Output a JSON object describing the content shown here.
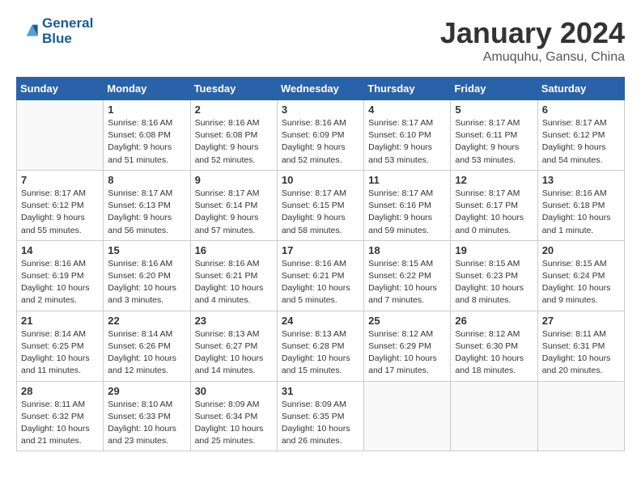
{
  "header": {
    "logo_general": "General",
    "logo_blue": "Blue",
    "title": "January 2024",
    "location": "Amuquhu, Gansu, China"
  },
  "days_of_week": [
    "Sunday",
    "Monday",
    "Tuesday",
    "Wednesday",
    "Thursday",
    "Friday",
    "Saturday"
  ],
  "weeks": [
    [
      {
        "day": "",
        "sunrise": "",
        "sunset": "",
        "daylight": ""
      },
      {
        "day": "1",
        "sunrise": "Sunrise: 8:16 AM",
        "sunset": "Sunset: 6:08 PM",
        "daylight": "Daylight: 9 hours and 51 minutes."
      },
      {
        "day": "2",
        "sunrise": "Sunrise: 8:16 AM",
        "sunset": "Sunset: 6:08 PM",
        "daylight": "Daylight: 9 hours and 52 minutes."
      },
      {
        "day": "3",
        "sunrise": "Sunrise: 8:16 AM",
        "sunset": "Sunset: 6:09 PM",
        "daylight": "Daylight: 9 hours and 52 minutes."
      },
      {
        "day": "4",
        "sunrise": "Sunrise: 8:17 AM",
        "sunset": "Sunset: 6:10 PM",
        "daylight": "Daylight: 9 hours and 53 minutes."
      },
      {
        "day": "5",
        "sunrise": "Sunrise: 8:17 AM",
        "sunset": "Sunset: 6:11 PM",
        "daylight": "Daylight: 9 hours and 53 minutes."
      },
      {
        "day": "6",
        "sunrise": "Sunrise: 8:17 AM",
        "sunset": "Sunset: 6:12 PM",
        "daylight": "Daylight: 9 hours and 54 minutes."
      }
    ],
    [
      {
        "day": "7",
        "sunrise": "Sunrise: 8:17 AM",
        "sunset": "Sunset: 6:12 PM",
        "daylight": "Daylight: 9 hours and 55 minutes."
      },
      {
        "day": "8",
        "sunrise": "Sunrise: 8:17 AM",
        "sunset": "Sunset: 6:13 PM",
        "daylight": "Daylight: 9 hours and 56 minutes."
      },
      {
        "day": "9",
        "sunrise": "Sunrise: 8:17 AM",
        "sunset": "Sunset: 6:14 PM",
        "daylight": "Daylight: 9 hours and 57 minutes."
      },
      {
        "day": "10",
        "sunrise": "Sunrise: 8:17 AM",
        "sunset": "Sunset: 6:15 PM",
        "daylight": "Daylight: 9 hours and 58 minutes."
      },
      {
        "day": "11",
        "sunrise": "Sunrise: 8:17 AM",
        "sunset": "Sunset: 6:16 PM",
        "daylight": "Daylight: 9 hours and 59 minutes."
      },
      {
        "day": "12",
        "sunrise": "Sunrise: 8:17 AM",
        "sunset": "Sunset: 6:17 PM",
        "daylight": "Daylight: 10 hours and 0 minutes."
      },
      {
        "day": "13",
        "sunrise": "Sunrise: 8:16 AM",
        "sunset": "Sunset: 6:18 PM",
        "daylight": "Daylight: 10 hours and 1 minute."
      }
    ],
    [
      {
        "day": "14",
        "sunrise": "Sunrise: 8:16 AM",
        "sunset": "Sunset: 6:19 PM",
        "daylight": "Daylight: 10 hours and 2 minutes."
      },
      {
        "day": "15",
        "sunrise": "Sunrise: 8:16 AM",
        "sunset": "Sunset: 6:20 PM",
        "daylight": "Daylight: 10 hours and 3 minutes."
      },
      {
        "day": "16",
        "sunrise": "Sunrise: 8:16 AM",
        "sunset": "Sunset: 6:21 PM",
        "daylight": "Daylight: 10 hours and 4 minutes."
      },
      {
        "day": "17",
        "sunrise": "Sunrise: 8:16 AM",
        "sunset": "Sunset: 6:21 PM",
        "daylight": "Daylight: 10 hours and 5 minutes."
      },
      {
        "day": "18",
        "sunrise": "Sunrise: 8:15 AM",
        "sunset": "Sunset: 6:22 PM",
        "daylight": "Daylight: 10 hours and 7 minutes."
      },
      {
        "day": "19",
        "sunrise": "Sunrise: 8:15 AM",
        "sunset": "Sunset: 6:23 PM",
        "daylight": "Daylight: 10 hours and 8 minutes."
      },
      {
        "day": "20",
        "sunrise": "Sunrise: 8:15 AM",
        "sunset": "Sunset: 6:24 PM",
        "daylight": "Daylight: 10 hours and 9 minutes."
      }
    ],
    [
      {
        "day": "21",
        "sunrise": "Sunrise: 8:14 AM",
        "sunset": "Sunset: 6:25 PM",
        "daylight": "Daylight: 10 hours and 11 minutes."
      },
      {
        "day": "22",
        "sunrise": "Sunrise: 8:14 AM",
        "sunset": "Sunset: 6:26 PM",
        "daylight": "Daylight: 10 hours and 12 minutes."
      },
      {
        "day": "23",
        "sunrise": "Sunrise: 8:13 AM",
        "sunset": "Sunset: 6:27 PM",
        "daylight": "Daylight: 10 hours and 14 minutes."
      },
      {
        "day": "24",
        "sunrise": "Sunrise: 8:13 AM",
        "sunset": "Sunset: 6:28 PM",
        "daylight": "Daylight: 10 hours and 15 minutes."
      },
      {
        "day": "25",
        "sunrise": "Sunrise: 8:12 AM",
        "sunset": "Sunset: 6:29 PM",
        "daylight": "Daylight: 10 hours and 17 minutes."
      },
      {
        "day": "26",
        "sunrise": "Sunrise: 8:12 AM",
        "sunset": "Sunset: 6:30 PM",
        "daylight": "Daylight: 10 hours and 18 minutes."
      },
      {
        "day": "27",
        "sunrise": "Sunrise: 8:11 AM",
        "sunset": "Sunset: 6:31 PM",
        "daylight": "Daylight: 10 hours and 20 minutes."
      }
    ],
    [
      {
        "day": "28",
        "sunrise": "Sunrise: 8:11 AM",
        "sunset": "Sunset: 6:32 PM",
        "daylight": "Daylight: 10 hours and 21 minutes."
      },
      {
        "day": "29",
        "sunrise": "Sunrise: 8:10 AM",
        "sunset": "Sunset: 6:33 PM",
        "daylight": "Daylight: 10 hours and 23 minutes."
      },
      {
        "day": "30",
        "sunrise": "Sunrise: 8:09 AM",
        "sunset": "Sunset: 6:34 PM",
        "daylight": "Daylight: 10 hours and 25 minutes."
      },
      {
        "day": "31",
        "sunrise": "Sunrise: 8:09 AM",
        "sunset": "Sunset: 6:35 PM",
        "daylight": "Daylight: 10 hours and 26 minutes."
      },
      {
        "day": "",
        "sunrise": "",
        "sunset": "",
        "daylight": ""
      },
      {
        "day": "",
        "sunrise": "",
        "sunset": "",
        "daylight": ""
      },
      {
        "day": "",
        "sunrise": "",
        "sunset": "",
        "daylight": ""
      }
    ]
  ]
}
